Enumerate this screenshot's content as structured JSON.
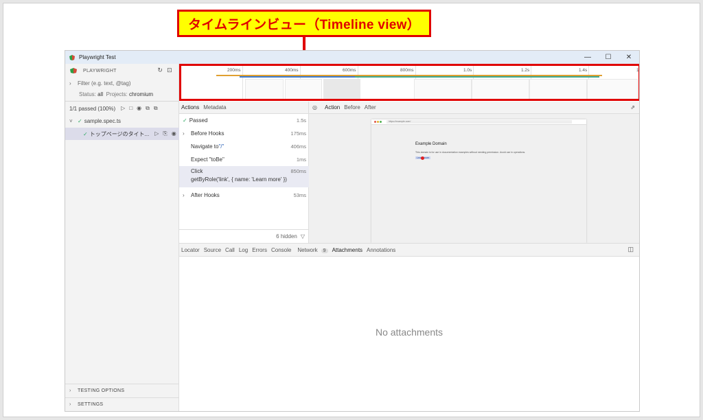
{
  "callout": {
    "text": "タイムラインビュー（Timeline view）"
  },
  "window": {
    "title": "Playwright Test",
    "minimize": "—",
    "maximize": "☐",
    "close": "✕"
  },
  "sidebar": {
    "header": "PLAYWRIGHT",
    "filter_placeholder": "Filter (e.g. text, @tag)",
    "status_label": "Status:",
    "status_value": "all",
    "projects_label": "Projects:",
    "projects_value": "chromium",
    "passed_summary": "1/1 passed (100%)",
    "file": "sample.spec.ts",
    "test": "トップページのタイト...",
    "testing_options": "TESTING OPTIONS",
    "settings": "SETTINGS"
  },
  "timeline": {
    "ticks": [
      "200ms",
      "400ms",
      "600ms",
      "800ms",
      "1.0s",
      "1.2s",
      "1.4s",
      "1"
    ]
  },
  "actions_panel": {
    "tabs": [
      "Actions",
      "Metadata"
    ],
    "items": [
      {
        "label": "Passed",
        "duration": "1.5s"
      },
      {
        "label": "Before Hooks",
        "duration": "175ms"
      },
      {
        "label": "Navigate to ",
        "label_extra": "\"/\"",
        "duration": "406ms"
      },
      {
        "label": "Expect \"toBe\"",
        "duration": "1ms"
      },
      {
        "label": "Click",
        "sub": "getByRole('link', { name: 'Learn more' })",
        "duration": "850ms"
      },
      {
        "label": "After Hooks",
        "duration": "53ms"
      }
    ],
    "hidden": "6 hidden"
  },
  "preview": {
    "tabs": [
      "Action",
      "Before",
      "After"
    ],
    "url": "https://example.com/",
    "page_title": "Example Domain",
    "page_text": "This domain is for use in documentation examples without needing permission. Avoid use in operations.",
    "page_link": "Learn more"
  },
  "details": {
    "tabs": [
      "Locator",
      "Source",
      "Call",
      "Log",
      "Errors",
      "Console",
      "Network",
      "Attachments",
      "Annotations"
    ],
    "network_count": "9",
    "empty_text": "No attachments"
  },
  "colors": {
    "callout_bg": "#ffff00",
    "callout_border": "#e00000",
    "accent": "#2a62b8"
  }
}
